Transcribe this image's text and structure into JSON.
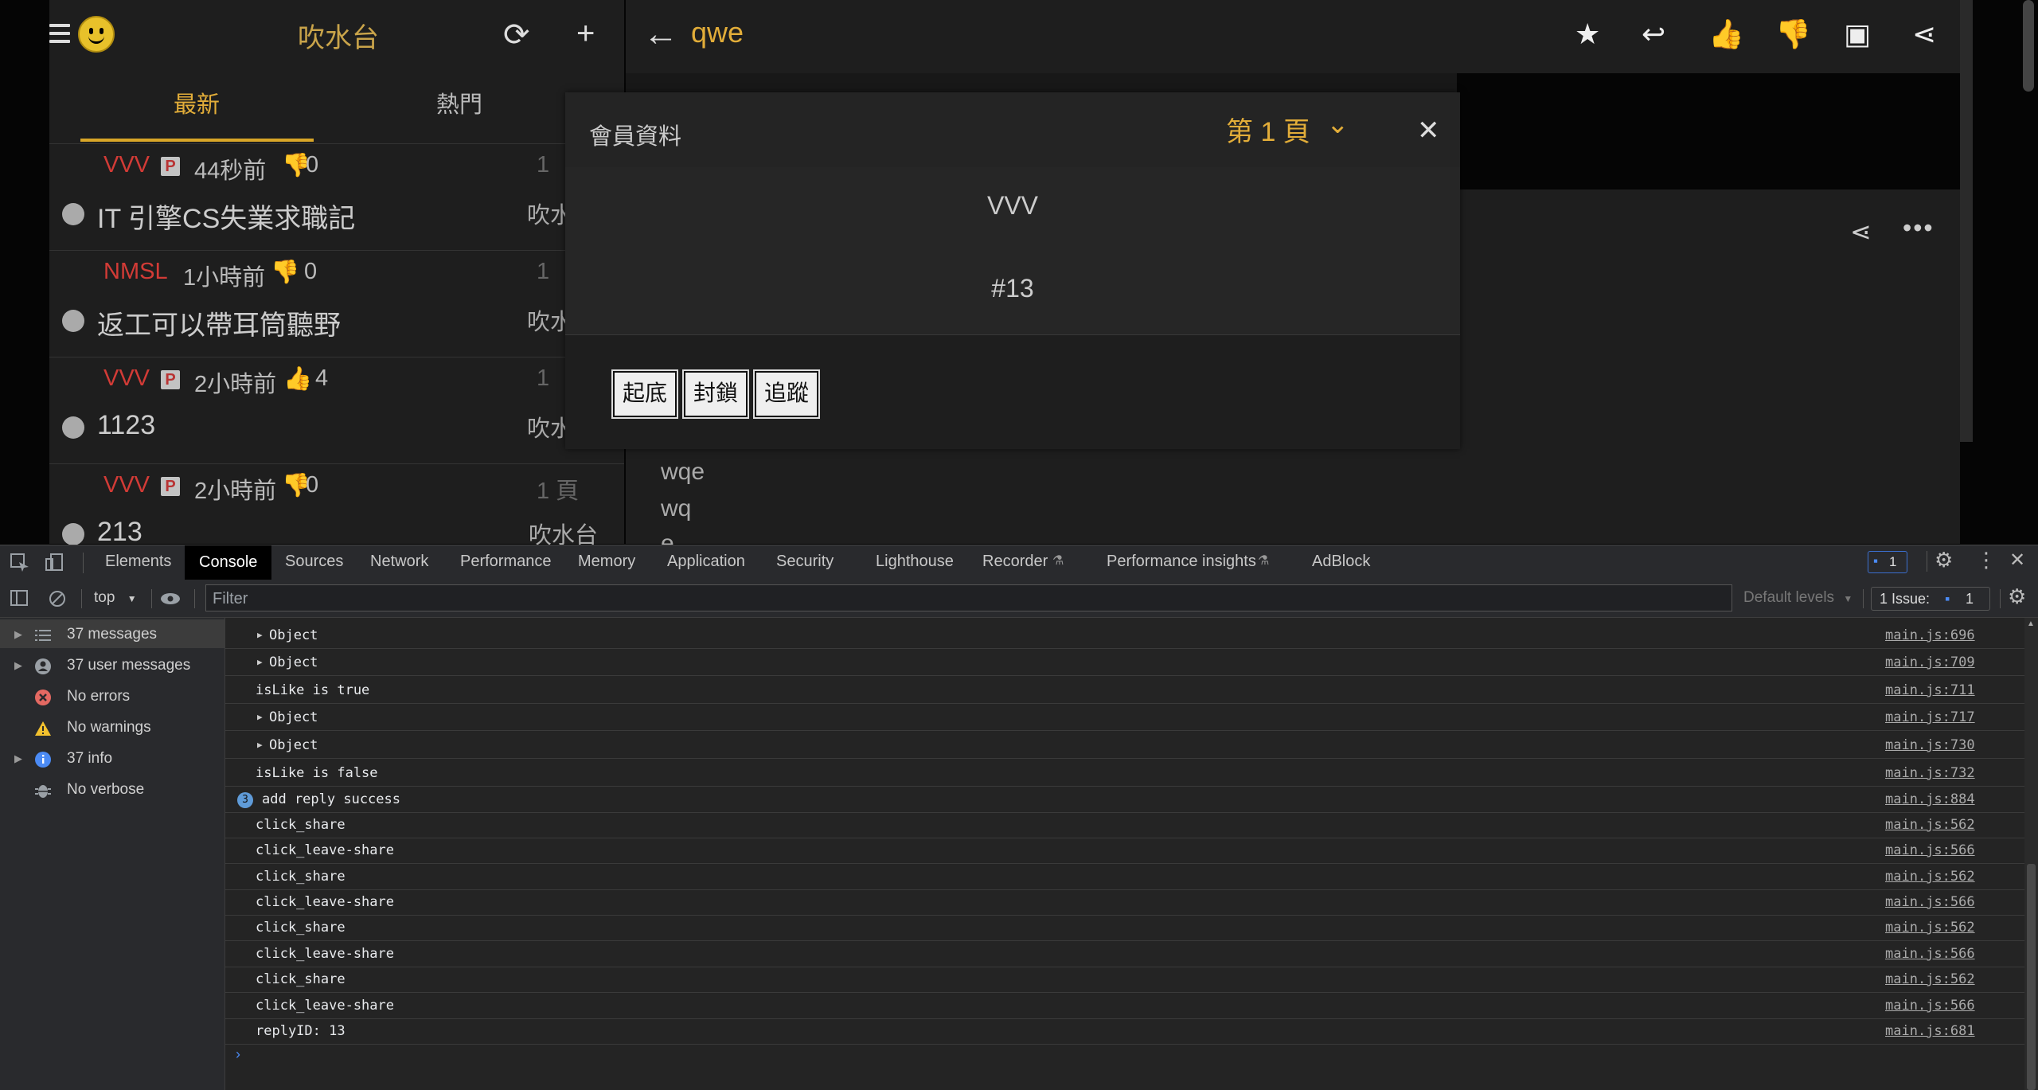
{
  "app": {
    "left_title": "吹水台",
    "tabs": [
      "最新",
      "熱門"
    ],
    "posts": [
      {
        "author": "VVV",
        "badge": "P",
        "time": "44秒前",
        "vote": "0",
        "vote_icon": "thumbs-down-icon",
        "title": "IT 引擎CS失業求職記",
        "page": "1",
        "board": "吹水"
      },
      {
        "author": "NMSL",
        "badge": "",
        "time": "1小時前",
        "vote": "0",
        "vote_icon": "thumbs-down-icon",
        "title": "返工可以帶耳筒聽野",
        "page": "1",
        "board": "吹水"
      },
      {
        "author": "VVV",
        "badge": "P",
        "time": "2小時前",
        "vote": "4",
        "vote_icon": "thumbs-up-icon",
        "title": "1123",
        "page": "1",
        "board": "吹水"
      },
      {
        "author": "VVV",
        "badge": "P",
        "time": "2小時前",
        "vote": "0",
        "vote_icon": "thumbs-down-icon",
        "title": "213",
        "page": "1 頁",
        "board": "吹水台"
      }
    ],
    "thread_title": "qwe",
    "reply_lines": [
      "wqe",
      "wq",
      "e"
    ],
    "colors": {
      "accent": "#e2ad39",
      "author_red": "#d23b36"
    }
  },
  "modal": {
    "title": "會員資料",
    "page_label": "第 1 頁",
    "name": "VVV",
    "number": "#13",
    "buttons": [
      "起底",
      "封鎖",
      "追蹤"
    ]
  },
  "devtools": {
    "tabs": [
      "Elements",
      "Console",
      "Sources",
      "Network",
      "Performance",
      "Memory",
      "Application",
      "Security",
      "Lighthouse",
      "Recorder",
      "Performance insights",
      "AdBlock"
    ],
    "issue_badge": "1",
    "context": "top",
    "filter_placeholder": "Filter",
    "default_levels": "Default levels",
    "issues_label": "1 Issue:",
    "issues_count": "1",
    "sidebar": [
      {
        "label": "37 messages",
        "icon": "list-icon",
        "expandable": true
      },
      {
        "label": "37 user messages",
        "icon": "user-icon",
        "expandable": true
      },
      {
        "label": "No errors",
        "icon": "error-icon",
        "expandable": false
      },
      {
        "label": "No warnings",
        "icon": "warning-icon",
        "expandable": false
      },
      {
        "label": "37 info",
        "icon": "info-icon",
        "expandable": true
      },
      {
        "label": "No verbose",
        "icon": "bug-icon",
        "expandable": false
      }
    ],
    "logs": [
      {
        "msg": "Object",
        "src": "main.js:696",
        "expandable": true
      },
      {
        "msg": "Object",
        "src": "main.js:709",
        "expandable": true
      },
      {
        "msg": "isLike is true",
        "src": "main.js:711",
        "expandable": false
      },
      {
        "msg": "Object",
        "src": "main.js:717",
        "expandable": true
      },
      {
        "msg": "Object",
        "src": "main.js:730",
        "expandable": true
      },
      {
        "msg": "isLike is false",
        "src": "main.js:732",
        "expandable": false
      },
      {
        "msg": "add reply success",
        "src": "main.js:884",
        "count": "3"
      },
      {
        "msg": "click_share",
        "src": "main.js:562"
      },
      {
        "msg": "click_leave-share",
        "src": "main.js:566"
      },
      {
        "msg": "click_share",
        "src": "main.js:562"
      },
      {
        "msg": "click_leave-share",
        "src": "main.js:566"
      },
      {
        "msg": "click_share",
        "src": "main.js:562"
      },
      {
        "msg": "click_leave-share",
        "src": "main.js:566"
      },
      {
        "msg": "click_share",
        "src": "main.js:562"
      },
      {
        "msg": "click_leave-share",
        "src": "main.js:566"
      },
      {
        "msg": "replyID: 13",
        "src": "main.js:681"
      }
    ]
  }
}
